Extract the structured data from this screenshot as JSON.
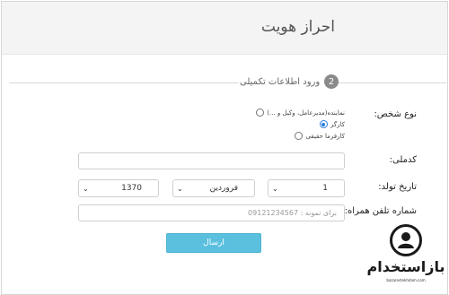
{
  "header": {
    "title": "احراز هویت"
  },
  "stepper": {
    "number": "2",
    "label": "ورود اطلاعات تکمیلی"
  },
  "form": {
    "person_type": {
      "label": "نوع شخص:",
      "options": [
        {
          "text": "نماینده(مدیرعامل، وکیل و ...)",
          "checked": false
        },
        {
          "text": "کارگر",
          "checked": true
        },
        {
          "text": "کارفرما حقیقی",
          "checked": false
        }
      ]
    },
    "national_code": {
      "label": "کدملی:",
      "value": ""
    },
    "birth_date": {
      "label": "تاریخ تولد:",
      "day": "1",
      "month": "فروردین",
      "year": "1370"
    },
    "phone": {
      "label": "شماره تلفن همراه:",
      "placeholder": "برای نمونه : 09121234567"
    },
    "submit_label": "ارسال"
  },
  "brand": {
    "name": "بازاستخدام",
    "tagline": "bazarestekhdam.com"
  },
  "colors": {
    "accent": "#5bc0de",
    "radio_checked": "#2a7de1"
  }
}
